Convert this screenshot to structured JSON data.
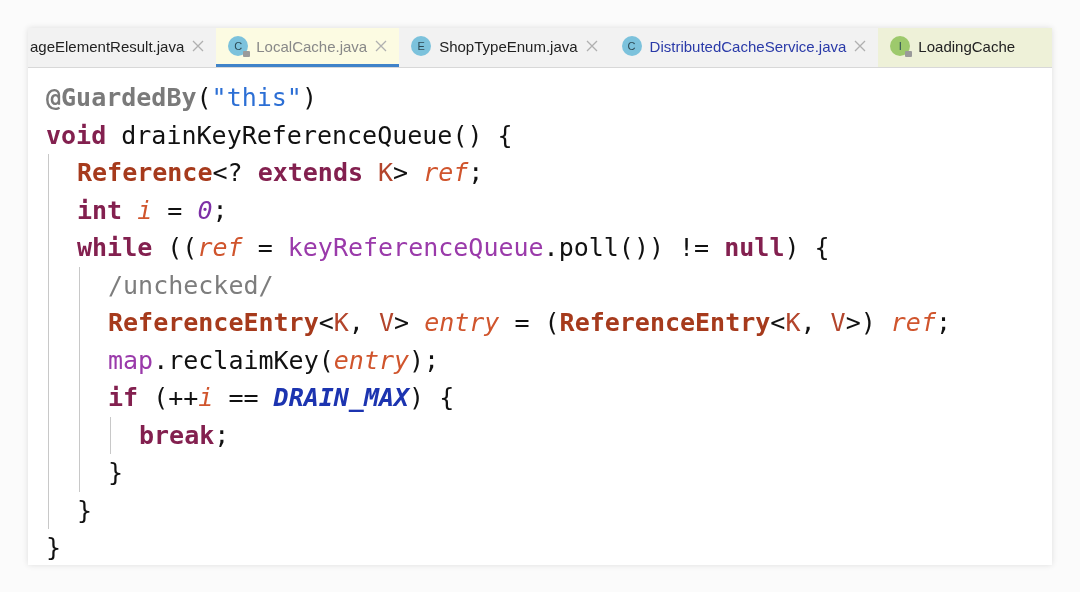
{
  "tabs": [
    {
      "label": "ageElementResult.java",
      "selected": false,
      "modified": false,
      "locked": false,
      "closable": true
    },
    {
      "label": "LocalCache.java",
      "icon": "C",
      "color": "#7cc2dc",
      "selected": true,
      "modified": false,
      "locked": true,
      "closable": true
    },
    {
      "label": "ShopTypeEnum.java",
      "icon": "E",
      "color": "#7cc2dc",
      "selected": false,
      "modified": false,
      "locked": false,
      "closable": true
    },
    {
      "label": "DistributedCacheService.java",
      "icon": "C",
      "color": "#7cc2dc",
      "selected": false,
      "modified": true,
      "locked": false,
      "closable": true
    },
    {
      "label": "LoadingCache",
      "icon": "I",
      "color": "#9dc96c",
      "selected": false,
      "modified": false,
      "locked": true,
      "closable": false
    }
  ],
  "code": [
    {
      "tokens": [
        {
          "kind": "annotation",
          "text": "@GuardedBy"
        },
        {
          "kind": "plain",
          "text": "("
        },
        {
          "kind": "string",
          "text": "\"this\""
        },
        {
          "kind": "plain",
          "text": ")"
        }
      ]
    },
    {
      "tokens": [
        {
          "kind": "keyword",
          "text": "void"
        },
        {
          "kind": "plain",
          "text": " drainKeyReferenceQueue() {"
        }
      ],
      "children": [
        {
          "tokens": [
            {
              "kind": "class",
              "text": "Reference"
            },
            {
              "kind": "plain",
              "text": "<? "
            },
            {
              "kind": "keyword",
              "text": "extends"
            },
            {
              "kind": "typeparam",
              "text": " K"
            },
            {
              "kind": "plain",
              "text": "> "
            },
            {
              "kind": "local",
              "text": "ref"
            },
            {
              "kind": "plain",
              "text": ";"
            }
          ]
        },
        {
          "tokens": [
            {
              "kind": "keyword",
              "text": "int"
            },
            {
              "kind": "local",
              "text": " i"
            },
            {
              "kind": "plain",
              "text": " = "
            },
            {
              "kind": "number",
              "text": "0"
            },
            {
              "kind": "plain",
              "text": ";"
            }
          ]
        },
        {
          "tokens": [
            {
              "kind": "keyword",
              "text": "while"
            },
            {
              "kind": "plain",
              "text": " (("
            },
            {
              "kind": "local",
              "text": "ref"
            },
            {
              "kind": "plain",
              "text": " = "
            },
            {
              "kind": "field",
              "text": "keyReferenceQueue"
            },
            {
              "kind": "plain",
              "text": ".poll()) != "
            },
            {
              "kind": "keyword",
              "text": "null"
            },
            {
              "kind": "plain",
              "text": ") {"
            }
          ],
          "children": [
            {
              "tokens": [
                {
                  "kind": "comment",
                  "text": "/unchecked/"
                }
              ]
            },
            {
              "tokens": [
                {
                  "kind": "class",
                  "text": "ReferenceEntry"
                },
                {
                  "kind": "plain",
                  "text": "<"
                },
                {
                  "kind": "typeparam",
                  "text": "K"
                },
                {
                  "kind": "plain",
                  "text": ", "
                },
                {
                  "kind": "typeparam",
                  "text": "V"
                },
                {
                  "kind": "plain",
                  "text": "> "
                },
                {
                  "kind": "local",
                  "text": "entry"
                },
                {
                  "kind": "plain",
                  "text": " = ("
                },
                {
                  "kind": "class",
                  "text": "ReferenceEntry"
                },
                {
                  "kind": "plain",
                  "text": "<"
                },
                {
                  "kind": "typeparam",
                  "text": "K"
                },
                {
                  "kind": "plain",
                  "text": ", "
                },
                {
                  "kind": "typeparam",
                  "text": "V"
                },
                {
                  "kind": "plain",
                  "text": ">) "
                },
                {
                  "kind": "local",
                  "text": "ref"
                },
                {
                  "kind": "plain",
                  "text": ";"
                }
              ]
            },
            {
              "tokens": [
                {
                  "kind": "field",
                  "text": "map"
                },
                {
                  "kind": "plain",
                  "text": ".reclaimKey("
                },
                {
                  "kind": "local",
                  "text": "entry"
                },
                {
                  "kind": "plain",
                  "text": ");"
                }
              ]
            },
            {
              "tokens": [
                {
                  "kind": "keyword",
                  "text": "if"
                },
                {
                  "kind": "plain",
                  "text": " (++"
                },
                {
                  "kind": "local",
                  "text": "i"
                },
                {
                  "kind": "plain",
                  "text": " == "
                },
                {
                  "kind": "constant",
                  "text": "DRAIN_MAX"
                },
                {
                  "kind": "plain",
                  "text": ") {"
                }
              ],
              "children": [
                {
                  "tokens": [
                    {
                      "kind": "keyword",
                      "text": "break"
                    },
                    {
                      "kind": "plain",
                      "text": ";"
                    }
                  ]
                }
              ]
            },
            {
              "tokens": [
                {
                  "kind": "plain",
                  "text": "}"
                }
              ]
            }
          ]
        },
        {
          "tokens": [
            {
              "kind": "plain",
              "text": "}"
            }
          ]
        }
      ]
    },
    {
      "tokens": [
        {
          "kind": "plain",
          "text": "}"
        }
      ]
    }
  ]
}
